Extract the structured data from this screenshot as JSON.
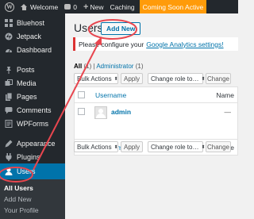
{
  "admin_bar": {
    "site_name": "Welcome",
    "comments_count": "0",
    "new_label": "New",
    "caching_label": "Caching",
    "coming_soon_label": "Coming Soon Active",
    "colors": {
      "background": "#23282d",
      "coming_soon": "#ff9b0a"
    }
  },
  "sidebar": {
    "items": [
      {
        "label": "Bluehost",
        "icon": "bluehost-icon"
      },
      {
        "label": "Jetpack",
        "icon": "jetpack-icon"
      },
      {
        "label": "Dashboard",
        "icon": "dashboard-icon"
      },
      {
        "label": "Posts",
        "icon": "pin-icon"
      },
      {
        "label": "Media",
        "icon": "media-icon"
      },
      {
        "label": "Pages",
        "icon": "pages-icon"
      },
      {
        "label": "Comments",
        "icon": "comments-icon"
      },
      {
        "label": "WPForms",
        "icon": "wpforms-icon"
      },
      {
        "label": "Appearance",
        "icon": "appearance-icon"
      },
      {
        "label": "Plugins",
        "icon": "plugins-icon"
      },
      {
        "label": "Users",
        "icon": "users-icon"
      }
    ],
    "submenu": [
      "All Users",
      "Add New",
      "Your Profile"
    ],
    "colors": {
      "background": "#23282d",
      "current": "#0073aa",
      "submenu": "#32373c"
    }
  },
  "main": {
    "title": "Users",
    "add_new_label": "Add New",
    "notice_text": "Please configure your",
    "notice_link": "Google Analytics settings!",
    "filter_all": "All",
    "filter_all_count": "(1)",
    "filter_admin": "Administrator",
    "filter_admin_count": "(1)",
    "bulk_actions_label": "Bulk Actions",
    "apply_label": "Apply",
    "change_role_label": "Change role to…",
    "change_label": "Change",
    "col_username": "Username",
    "col_name": "Name",
    "rows": [
      {
        "username": "admin",
        "name": "—"
      }
    ],
    "colors": {
      "link": "#0073aa",
      "notice_border": "#dc3232",
      "annotation": "#e8464f"
    }
  }
}
